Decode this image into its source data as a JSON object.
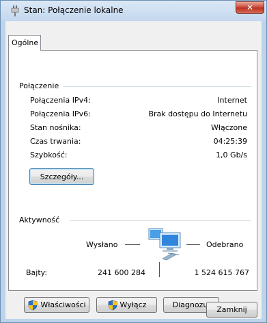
{
  "window": {
    "title": "Stan: Połączenie lokalne",
    "close_label": "✕"
  },
  "tab": {
    "label": "Ogólne"
  },
  "connection": {
    "group_label": "Połączenie",
    "rows": [
      {
        "label": "Połączenia IPv4:",
        "value": "Internet"
      },
      {
        "label": "Połączenia IPv6:",
        "value": "Brak dostępu do Internetu"
      },
      {
        "label": "Stan nośnika:",
        "value": "Włączone"
      },
      {
        "label": "Czas trwania:",
        "value": "04:25:39"
      },
      {
        "label": "Szybkość:",
        "value": "1,0 Gb/s"
      }
    ],
    "details_button": "Szczegóły..."
  },
  "activity": {
    "group_label": "Aktywność",
    "sent_label": "Wysłano",
    "received_label": "Odebrano",
    "bytes_label": "Bajty:",
    "bytes_sent": "241 600 284",
    "bytes_received": "1 524 615 767"
  },
  "buttons": {
    "properties": "Właściwości",
    "disable": "Wyłącz",
    "diagnose": "Diagnozuj",
    "close": "Zamknij"
  },
  "icons": {
    "title": "network-plug-icon",
    "shield": "uac-shield-icon",
    "network": "network-computers-icon"
  }
}
